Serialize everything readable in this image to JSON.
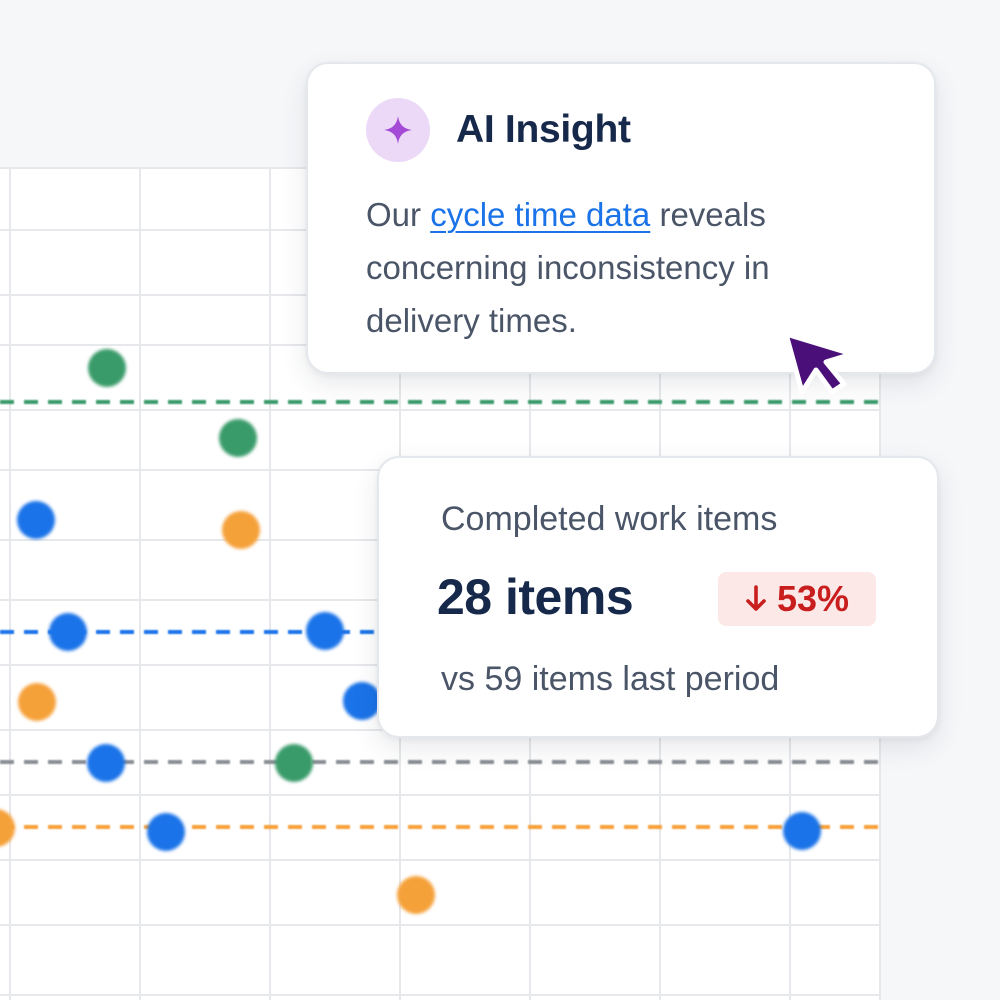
{
  "chart": {
    "grid_color": "#e6e8eb",
    "colors": {
      "green": "#3a9b6a",
      "blue": "#1a73e8",
      "orange": "#f5a13a",
      "gray": "#8a8f96"
    }
  },
  "insight": {
    "title": "AI Insight",
    "icon": "sparkle-icon",
    "body_prefix": "Our ",
    "link_text": "cycle time data",
    "body_suffix": " reveals concerning inconsistency in delivery times."
  },
  "stats": {
    "label": "Completed work items",
    "value": "28 items",
    "change": "53%",
    "change_direction": "down",
    "comparison": "vs 59 items last period"
  },
  "cursor": {
    "icon": "cursor-arrow-icon",
    "color": "#4b0f7a"
  }
}
